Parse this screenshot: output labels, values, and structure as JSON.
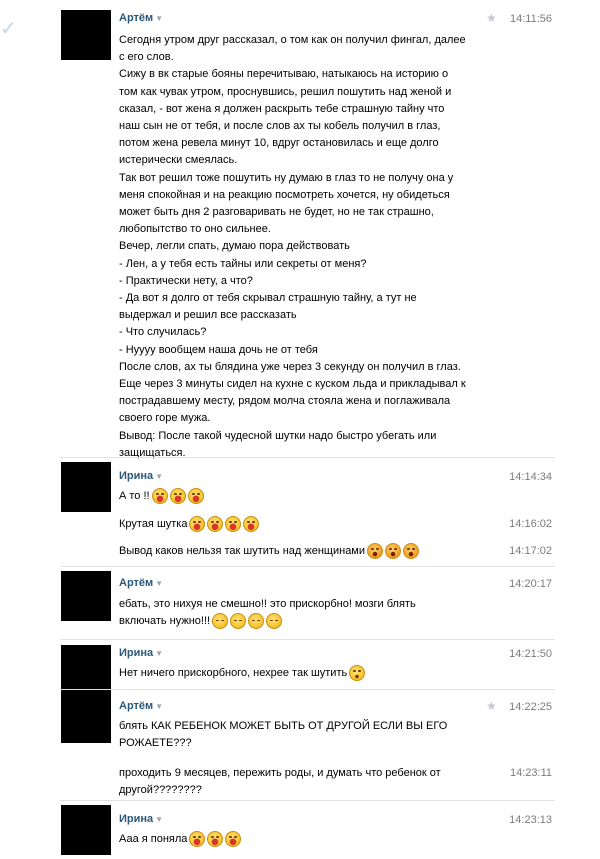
{
  "messages": [
    {
      "author": "Артём",
      "time": "14:11:56",
      "lines": [
        "Сегодня утром друг рассказал, о том как он получил фингал, далее",
        "с его слов.",
        "Сижу в вк старые бояны перечитываю, натыкаюсь на историю о",
        "том как чувак утром, проснувшись, решил пошутить над женой и",
        "сказал, - вот жена я должен раскрыть тебе страшную тайну что",
        "наш сын не от тебя, и после слов ах ты кобель получил в глаз,",
        "потом жена ревела минут 10, вдруг остановилась и еще долго",
        "истерически смеялась.",
        "Так вот решил тоже пошутить ну думаю в глаз то не получу она у",
        "меня спокойная и на реакцию посмотреть хочется, ну обидеться",
        "может быть дня 2 разговаривать не будет, но не так страшно,",
        "любопытство то оно сильнее.",
        "Вечер, легли спать, думаю пора действовать",
        "- Лен, а у тебя есть тайны или секреты от меня?",
        "- Практически нету, а что?",
        "- Да вот я долго от тебя скрывал страшную тайну, а тут не",
        "выдержал и решил все рассказать",
        "- Что случилась?",
        "- Нуууу вообщем наша дочь не от тебя",
        "После слов, ах ты блядина уже через 3 секунду он получил в глаз.",
        "Еще через 3 минуты сидел на кухне с куском льда и прикладывал к",
        "пострадавшему месту, рядом молча стояла жена и поглаживала",
        "своего горе мужа.",
        "Вывод: После такой чудесной шутки надо быстро убегать или",
        "защищаться."
      ]
    },
    {
      "author": "Ирина",
      "time": "14:14:34",
      "text": "А то !!"
    },
    {
      "time": "14:16:02",
      "text": "Крутая шутка"
    },
    {
      "time": "14:17:02",
      "text": "Вывод каков нельзя так шутить над женщинами"
    },
    {
      "author": "Артём",
      "time": "14:20:17",
      "lines": [
        "ебать, это нихуя не смешно!! это прискорбно! мозги блять",
        "включать нужно!!!"
      ]
    },
    {
      "author": "Ирина",
      "time": "14:21:50",
      "text": "Нет ничего прискорбного, нехрее так шутить"
    },
    {
      "author": "Артём",
      "time": "14:22:25",
      "lines": [
        "блять КАК РЕБЕНОК МОЖЕТ БЫТЬ ОТ ДРУГОЙ ЕСЛИ ВЫ ЕГО",
        "РОЖАЕТЕ???"
      ]
    },
    {
      "time": "14:23:11",
      "lines": [
        "проходить 9 месяцев, пережить роды, и думать что ребенок от",
        "другой????????"
      ]
    },
    {
      "author": "Ирина",
      "time": "14:23:13",
      "text": "Ааа я поняла"
    }
  ],
  "icons": {
    "star": "star-icon",
    "caret": "caret-down-icon",
    "check": "checkmark-icon",
    "emoji": "smiley-emoji-icon"
  }
}
